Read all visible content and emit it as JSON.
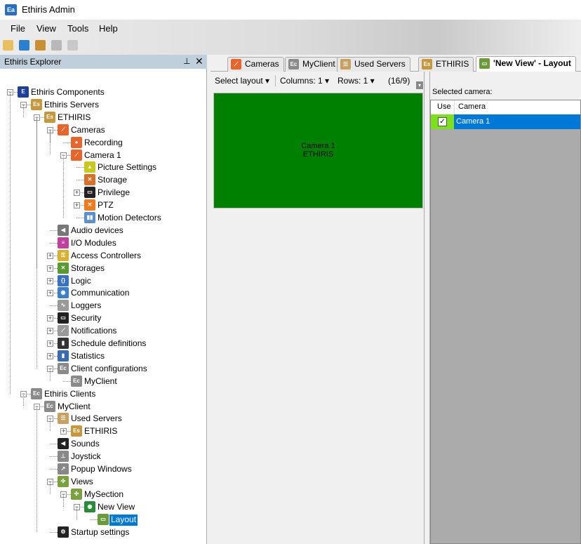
{
  "window": {
    "title": "Ethiris Admin",
    "icon_text": "Ea"
  },
  "menu": [
    "File",
    "View",
    "Tools",
    "Help"
  ],
  "toolbar": [
    {
      "name": "new-icon",
      "color": "#e8c060"
    },
    {
      "name": "settings-icon",
      "color": "#2a7fd0"
    },
    {
      "name": "open-icon",
      "color": "#c89030"
    },
    {
      "name": "save-icon",
      "color": "#b8b8b8"
    },
    {
      "name": "save-all-icon",
      "color": "#c8c8c8"
    }
  ],
  "explorer": {
    "title": "Ethiris Explorer",
    "pin": "📌",
    "close": "✕"
  },
  "tree": [
    {
      "label": "Ethiris Components",
      "level": 0,
      "state": "expanded",
      "icon": "components-icon",
      "color": "#1f3fa0",
      "glyph": "E"
    },
    {
      "label": "Ethiris Servers",
      "level": 1,
      "state": "expanded",
      "icon": "servers-icon",
      "color": "#c8963c",
      "glyph": "Es"
    },
    {
      "label": "ETHIRIS",
      "level": 2,
      "state": "expanded",
      "icon": "server-icon",
      "color": "#c8963c",
      "glyph": "Es"
    },
    {
      "label": "Cameras",
      "level": 3,
      "state": "expanded",
      "icon": "cameras-icon",
      "color": "#e8642a",
      "glyph": "⟋"
    },
    {
      "label": "Recording",
      "level": 4,
      "state": "leaf",
      "icon": "recording-icon",
      "color": "#e8642a",
      "glyph": "●"
    },
    {
      "label": "Camera 1",
      "level": 4,
      "state": "expanded",
      "icon": "camera-icon",
      "color": "#e8642a",
      "glyph": "⟋"
    },
    {
      "label": "Picture Settings",
      "level": 5,
      "state": "leaf",
      "icon": "picture-settings-icon",
      "color": "#c8c820",
      "glyph": "▲"
    },
    {
      "label": "Storage",
      "level": 5,
      "state": "leaf",
      "icon": "storage-icon",
      "color": "#d8702a",
      "glyph": "✕"
    },
    {
      "label": "Privilege",
      "level": 5,
      "state": "collapsed",
      "icon": "privilege-icon",
      "color": "#222",
      "glyph": "▭"
    },
    {
      "label": "PTZ",
      "level": 5,
      "state": "collapsed",
      "icon": "ptz-icon",
      "color": "#f07a20",
      "glyph": "✕"
    },
    {
      "label": "Motion Detectors",
      "level": 5,
      "state": "leaf",
      "icon": "motion-detector-icon",
      "color": "#5a8fd0",
      "glyph": "▮▮"
    },
    {
      "label": "Audio devices",
      "level": 3,
      "state": "leaf",
      "icon": "speaker-icon",
      "color": "#777",
      "glyph": "◀"
    },
    {
      "label": "I/O Modules",
      "level": 3,
      "state": "leaf",
      "icon": "io-modules-icon",
      "color": "#c040a0",
      "glyph": "≡"
    },
    {
      "label": "Access Controllers",
      "level": 3,
      "state": "collapsed",
      "icon": "access-controller-icon",
      "color": "#d8b030",
      "glyph": "⚿"
    },
    {
      "label": "Storages",
      "level": 3,
      "state": "collapsed",
      "icon": "storages-icon",
      "color": "#5a9a30",
      "glyph": "✕"
    },
    {
      "label": "Logic",
      "level": 3,
      "state": "collapsed",
      "icon": "logic-icon",
      "color": "#3a70c0",
      "glyph": "{}"
    },
    {
      "label": "Communication",
      "level": 3,
      "state": "collapsed",
      "icon": "communication-icon",
      "color": "#3a80c8",
      "glyph": "◉"
    },
    {
      "label": "Loggers",
      "level": 3,
      "state": "leaf",
      "icon": "loggers-icon",
      "color": "#9a9a9a",
      "glyph": "∿"
    },
    {
      "label": "Security",
      "level": 3,
      "state": "collapsed",
      "icon": "security-icon",
      "color": "#222",
      "glyph": "▭"
    },
    {
      "label": "Notifications",
      "level": 3,
      "state": "collapsed",
      "icon": "notifications-icon",
      "color": "#9a9a9a",
      "glyph": "⟋"
    },
    {
      "label": "Schedule definitions",
      "level": 3,
      "state": "collapsed",
      "icon": "schedule-icon",
      "color": "#333",
      "glyph": "▮"
    },
    {
      "label": "Statistics",
      "level": 3,
      "state": "collapsed",
      "icon": "statistics-icon",
      "color": "#3a6ab0",
      "glyph": "▮"
    },
    {
      "label": "Client configurations",
      "level": 3,
      "state": "expanded",
      "icon": "client-configurations-icon",
      "color": "#8a8a8a",
      "glyph": "Ec"
    },
    {
      "label": "MyClient",
      "level": 4,
      "state": "leaf",
      "icon": "client-icon",
      "color": "#8a8a8a",
      "glyph": "Ec"
    },
    {
      "label": "Ethiris Clients",
      "level": 1,
      "state": "expanded",
      "icon": "clients-icon",
      "color": "#8a8a8a",
      "glyph": "Ec"
    },
    {
      "label": "MyClient",
      "level": 2,
      "state": "expanded",
      "icon": "client-icon",
      "color": "#8a8a8a",
      "glyph": "Ec"
    },
    {
      "label": "Used Servers",
      "level": 3,
      "state": "expanded",
      "icon": "used-servers-icon",
      "color": "#c8a060",
      "glyph": "☰"
    },
    {
      "label": "ETHIRIS",
      "level": 4,
      "state": "collapsed",
      "icon": "server-icon",
      "color": "#c8963c",
      "glyph": "Es"
    },
    {
      "label": "Sounds",
      "level": 3,
      "state": "leaf",
      "icon": "sounds-icon",
      "color": "#222",
      "glyph": "◀"
    },
    {
      "label": "Joystick",
      "level": 3,
      "state": "leaf",
      "icon": "joystick-icon",
      "color": "#888",
      "glyph": "⊥"
    },
    {
      "label": "Popup Windows",
      "level": 3,
      "state": "leaf",
      "icon": "popup-windows-icon",
      "color": "#888",
      "glyph": "↗"
    },
    {
      "label": "Views",
      "level": 3,
      "state": "expanded",
      "icon": "views-icon",
      "color": "#7aa040",
      "glyph": "✣"
    },
    {
      "label": "MySection",
      "level": 4,
      "state": "expanded",
      "icon": "section-icon",
      "color": "#7aa040",
      "glyph": "✣"
    },
    {
      "label": "New View",
      "level": 5,
      "state": "expanded",
      "icon": "view-icon",
      "color": "#2a8a3a",
      "glyph": "◉"
    },
    {
      "label": "Layout",
      "level": 6,
      "state": "leaf",
      "icon": "layout-icon",
      "color": "#6a9a3a",
      "glyph": "▭",
      "selected": true
    },
    {
      "label": "Startup settings",
      "level": 3,
      "state": "leaf",
      "icon": "startup-settings-icon",
      "color": "#222",
      "glyph": "⚙"
    }
  ],
  "tabs": [
    {
      "label": "Cameras",
      "icon": "cameras-icon",
      "color": "#e8642a",
      "glyph": "⟋"
    },
    {
      "label": "MyClient",
      "icon": "client-icon",
      "color": "#8a8a8a",
      "glyph": "Ec"
    },
    {
      "label": "Used Servers",
      "icon": "used-servers-icon",
      "color": "#c8a060",
      "glyph": "☰"
    },
    {
      "label": "ETHIRIS",
      "icon": "server-icon",
      "color": "#c8963c",
      "glyph": "Es"
    },
    {
      "label": "'New View' - Layout",
      "icon": "layout-icon",
      "color": "#6a9a3a",
      "glyph": "▭",
      "active": true
    }
  ],
  "layout_toolbar": {
    "select_layout": "Select layout ▾",
    "columns": "Columns:  1 ▾",
    "rows": "Rows:  1 ▾",
    "aspect": "(16/9)"
  },
  "camera_cell": {
    "name": "Camera 1",
    "server": "ETHIRIS",
    "color": "#008000"
  },
  "right": {
    "selected_label": "Selected camera:",
    "columns": [
      "Use",
      "Camera"
    ],
    "rows": [
      {
        "use": true,
        "camera": "Camera 1"
      }
    ]
  }
}
